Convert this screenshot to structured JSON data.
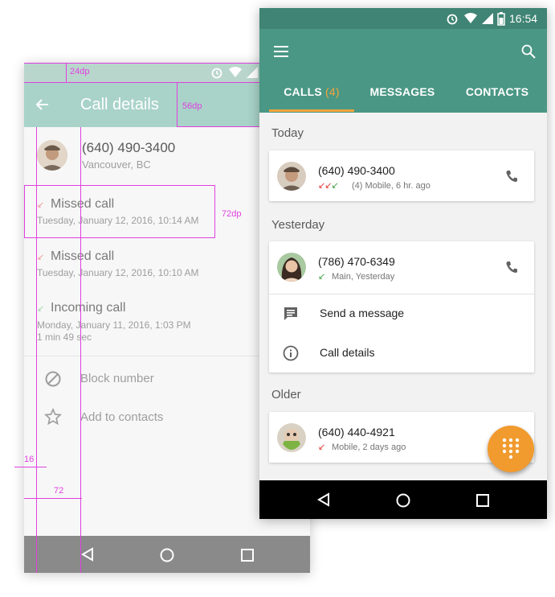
{
  "colors": {
    "accent": "#f3a43a",
    "primary": "#4a9785",
    "primary_dark": "#3f8474",
    "guide": "#e040e0",
    "missed": "#e53935",
    "incoming": "#43a047"
  },
  "back_phone": {
    "title": "Call details",
    "contact": {
      "number": "(640) 490-3400",
      "location": "Vancouver, BC"
    },
    "history": [
      {
        "type": "Missed call",
        "date": "Tuesday, January 12, 2016, 10:14 AM",
        "duration": ""
      },
      {
        "type": "Missed call",
        "date": "Tuesday, January 12, 2016, 10:10 AM",
        "duration": ""
      },
      {
        "type": "Incoming call",
        "date": "Monday, January 11, 2016, 1:03 PM",
        "duration": "1 min 49 sec"
      }
    ],
    "actions": [
      {
        "label": "Block number",
        "icon": "block-icon"
      },
      {
        "label": "Add to contacts",
        "icon": "star-outline-icon"
      }
    ],
    "annotations": {
      "status_height": "24dp",
      "appbar_height": "56dp",
      "row_height": "72dp",
      "left_margin": "16",
      "keyline": "72"
    }
  },
  "front_phone": {
    "time": "16:54",
    "tabs": [
      {
        "label": "CALLS",
        "count": "(4)",
        "selected": true
      },
      {
        "label": "MESSAGES",
        "count": "",
        "selected": false
      },
      {
        "label": "CONTACTS",
        "count": "",
        "selected": false
      }
    ],
    "sections": [
      {
        "header": "Today"
      },
      {
        "header": "Yesterday"
      },
      {
        "header": "Older"
      }
    ],
    "calls": [
      {
        "number": "(640) 490-3400",
        "detail": "(4)  Mobile, 6 hr. ago"
      },
      {
        "number": "(786) 470-6349",
        "detail": "Main, Yesterday"
      },
      {
        "number": "(640) 440-4921",
        "detail": "Mobile, 2 days ago"
      }
    ],
    "expanded_actions": [
      {
        "label": "Send a message",
        "icon": "message-icon"
      },
      {
        "label": "Call details",
        "icon": "info-icon"
      }
    ]
  }
}
